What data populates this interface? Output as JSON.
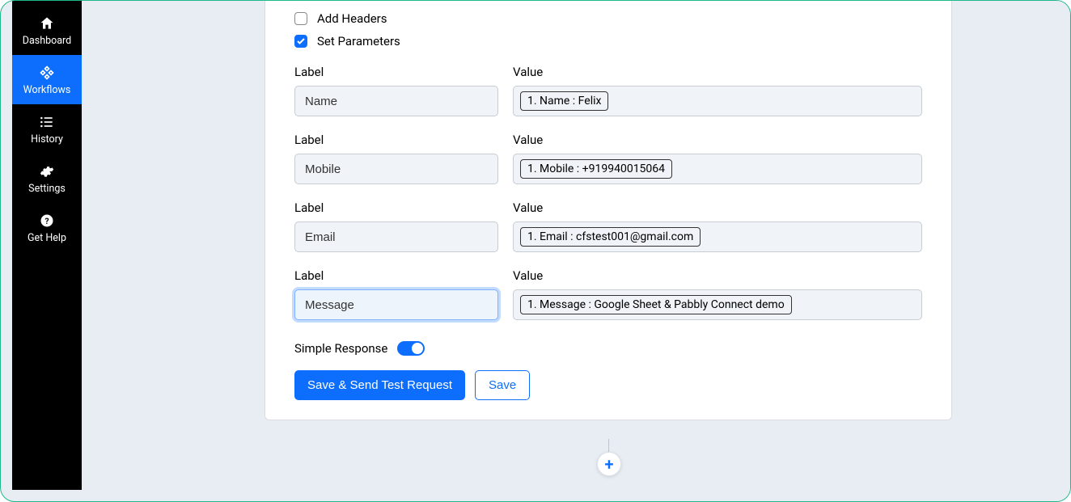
{
  "sidebar": {
    "items": [
      {
        "label": "Dashboard"
      },
      {
        "label": "Workflows"
      },
      {
        "label": "History"
      },
      {
        "label": "Settings"
      },
      {
        "label": "Get Help"
      }
    ]
  },
  "form": {
    "checkboxes": {
      "add_headers": "Add Headers",
      "set_parameters": "Set Parameters"
    },
    "label_header": "Label",
    "value_header": "Value",
    "params": [
      {
        "label": "Name",
        "value": "1. Name : Felix"
      },
      {
        "label": "Mobile",
        "value": "1. Mobile : +919940015064"
      },
      {
        "label": "Email",
        "value": "1. Email : cfstest001@gmail.com"
      },
      {
        "label": "Message",
        "value": "1. Message : Google Sheet & Pabbly Connect demo"
      }
    ],
    "simple_response_label": "Simple Response",
    "buttons": {
      "save_send": "Save & Send Test Request",
      "save": "Save"
    }
  },
  "add_button": "+"
}
